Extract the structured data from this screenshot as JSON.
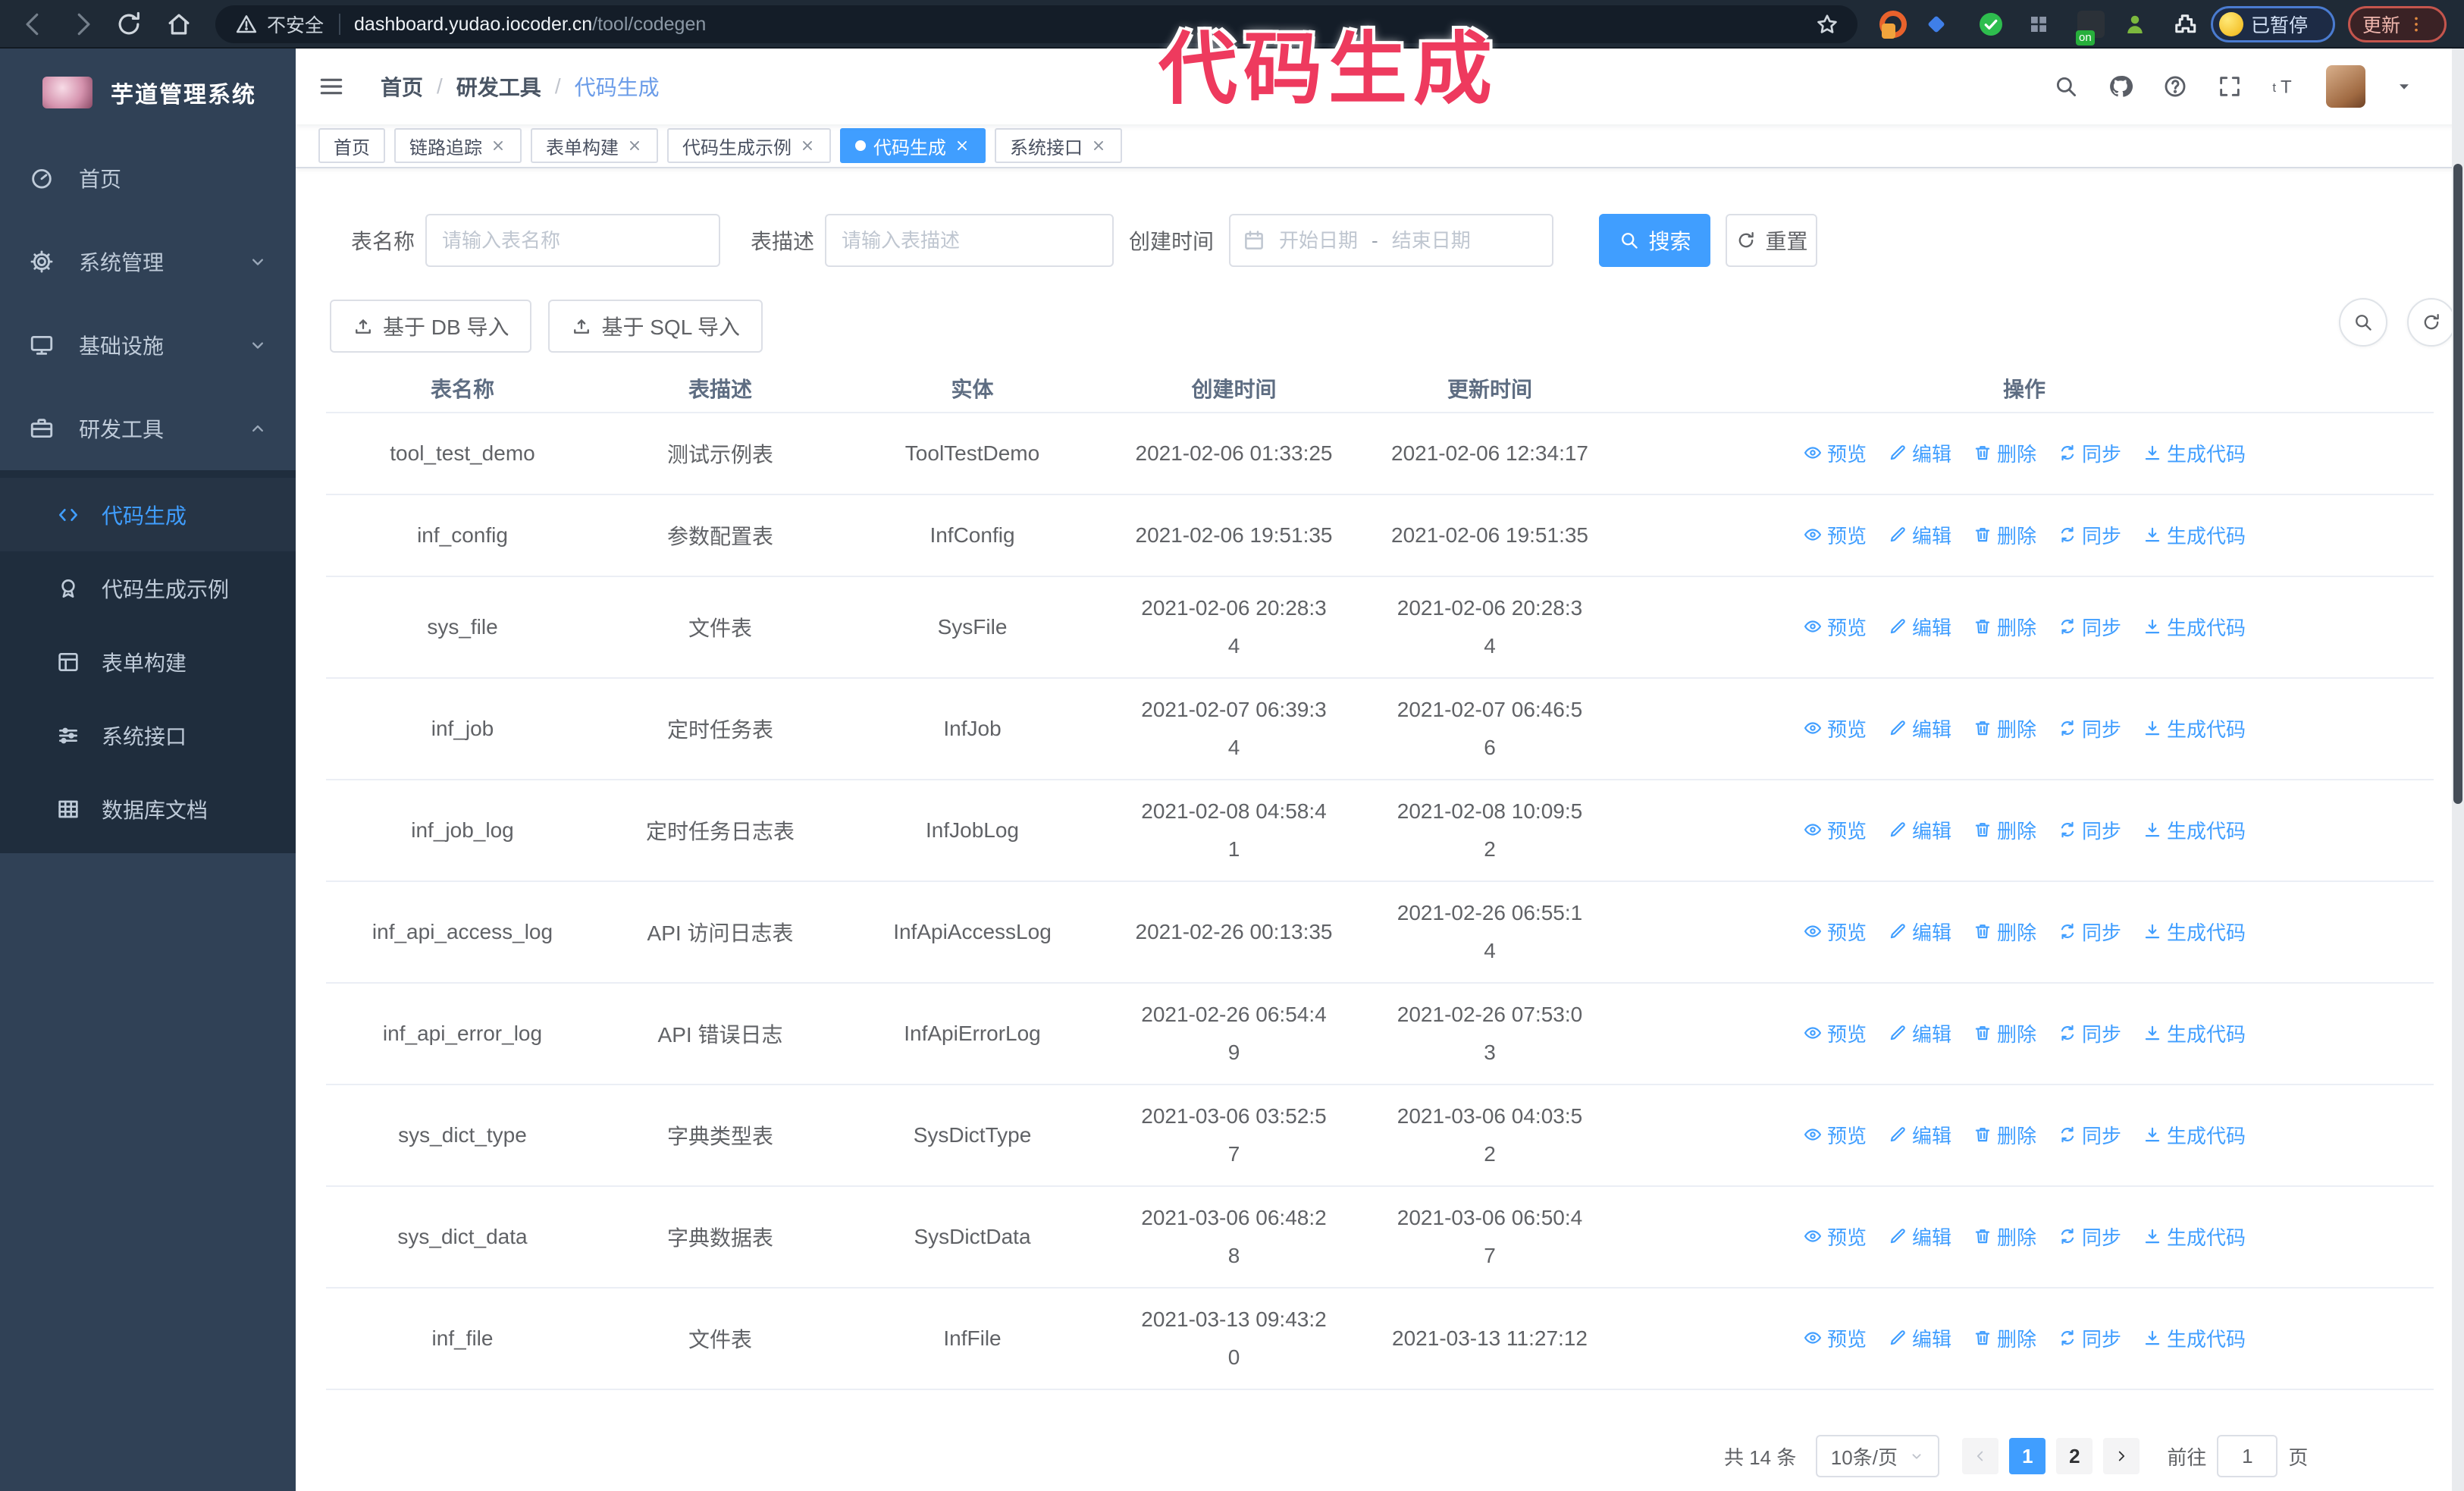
{
  "browser": {
    "security_label": "不安全",
    "url_host": "dashboard.yudao.iocoder.cn",
    "url_path": "/tool/codegen",
    "extension_on_label": "on",
    "paused_badge": "已暂停",
    "update_badge": "更新"
  },
  "annotation": {
    "title": "代码生成"
  },
  "sidebar": {
    "app_title": "芋道管理系统",
    "items": [
      {
        "label": "首页",
        "icon": "dashboard-icon",
        "chevron": ""
      },
      {
        "label": "系统管理",
        "icon": "gear-icon",
        "chevron": "down"
      },
      {
        "label": "基础设施",
        "icon": "monitor-icon",
        "chevron": "down"
      },
      {
        "label": "研发工具",
        "icon": "toolbox-icon",
        "chevron": "up"
      }
    ],
    "sub_items": [
      {
        "label": "代码生成",
        "icon": "code-icon",
        "active": true
      },
      {
        "label": "代码生成示例",
        "icon": "badge-icon",
        "active": false
      },
      {
        "label": "表单构建",
        "icon": "form-icon",
        "active": false
      },
      {
        "label": "系统接口",
        "icon": "sliders-icon",
        "active": false
      },
      {
        "label": "数据库文档",
        "icon": "db-table-icon",
        "active": false
      }
    ]
  },
  "header": {
    "breadcrumb": [
      "首页",
      "研发工具",
      "代码生成"
    ],
    "breadcrumb_separator": "/"
  },
  "tags": [
    {
      "label": "首页",
      "closable": false,
      "active": false
    },
    {
      "label": "链路追踪",
      "closable": true,
      "active": false
    },
    {
      "label": "表单构建",
      "closable": true,
      "active": false
    },
    {
      "label": "代码生成示例",
      "closable": true,
      "active": false
    },
    {
      "label": "代码生成",
      "closable": true,
      "active": true
    },
    {
      "label": "系统接口",
      "closable": true,
      "active": false
    }
  ],
  "search": {
    "name_label": "表名称",
    "name_placeholder": "请输入表名称",
    "desc_label": "表描述",
    "desc_placeholder": "请输入表描述",
    "time_label": "创建时间",
    "start_placeholder": "开始日期",
    "separator": "-",
    "end_placeholder": "结束日期",
    "search_button": "搜索",
    "reset_button": "重置"
  },
  "toolbar": {
    "import_db": "基于 DB 导入",
    "import_sql": "基于 SQL 导入"
  },
  "table": {
    "headers": [
      "表名称",
      "表描述",
      "实体",
      "创建时间",
      "更新时间",
      "操作"
    ],
    "actions": [
      {
        "label": "预览",
        "icon": "eye-icon"
      },
      {
        "label": "编辑",
        "icon": "edit-icon"
      },
      {
        "label": "删除",
        "icon": "delete-icon"
      },
      {
        "label": "同步",
        "icon": "sync-icon"
      },
      {
        "label": "生成代码",
        "icon": "download-icon"
      }
    ],
    "rows": [
      {
        "name": "tool_test_demo",
        "desc": "测试示例表",
        "entity": "ToolTestDemo",
        "created": "2021-02-06 01:33:25",
        "updated": "2021-02-06 12:34:17"
      },
      {
        "name": "inf_config",
        "desc": "参数配置表",
        "entity": "InfConfig",
        "created": "2021-02-06 19:51:35",
        "updated": "2021-02-06 19:51:35"
      },
      {
        "name": "sys_file",
        "desc": "文件表",
        "entity": "SysFile",
        "created": "2021-02-06 20:28:3\n4",
        "updated": "2021-02-06 20:28:3\n4"
      },
      {
        "name": "inf_job",
        "desc": "定时任务表",
        "entity": "InfJob",
        "created": "2021-02-07 06:39:3\n4",
        "updated": "2021-02-07 06:46:5\n6"
      },
      {
        "name": "inf_job_log",
        "desc": "定时任务日志表",
        "entity": "InfJobLog",
        "created": "2021-02-08 04:58:4\n1",
        "updated": "2021-02-08 10:09:5\n2"
      },
      {
        "name": "inf_api_access_log",
        "desc": "API 访问日志表",
        "entity": "InfApiAccessLog",
        "created": "2021-02-26 00:13:35",
        "updated": "2021-02-26 06:55:1\n4"
      },
      {
        "name": "inf_api_error_log",
        "desc": "API 错误日志",
        "entity": "InfApiErrorLog",
        "created": "2021-02-26 06:54:4\n9",
        "updated": "2021-02-26 07:53:0\n3"
      },
      {
        "name": "sys_dict_type",
        "desc": "字典类型表",
        "entity": "SysDictType",
        "created": "2021-03-06 03:52:5\n7",
        "updated": "2021-03-06 04:03:5\n2"
      },
      {
        "name": "sys_dict_data",
        "desc": "字典数据表",
        "entity": "SysDictData",
        "created": "2021-03-06 06:48:2\n8",
        "updated": "2021-03-06 06:50:4\n7"
      },
      {
        "name": "inf_file",
        "desc": "文件表",
        "entity": "InfFile",
        "created": "2021-03-13 09:43:2\n0",
        "updated": "2021-03-13 11:27:12"
      }
    ]
  },
  "pagination": {
    "total": "共 14 条",
    "page_size": "10条/页",
    "pages": [
      "1",
      "2"
    ],
    "active_page": "1",
    "goto_label": "前往",
    "goto_value": "1",
    "page_unit": "页"
  },
  "colors": {
    "primary": "#409eff",
    "sidebar_bg": "#304156",
    "submenu_bg": "#1f2d3d",
    "annotation": "#ee3a5e"
  }
}
